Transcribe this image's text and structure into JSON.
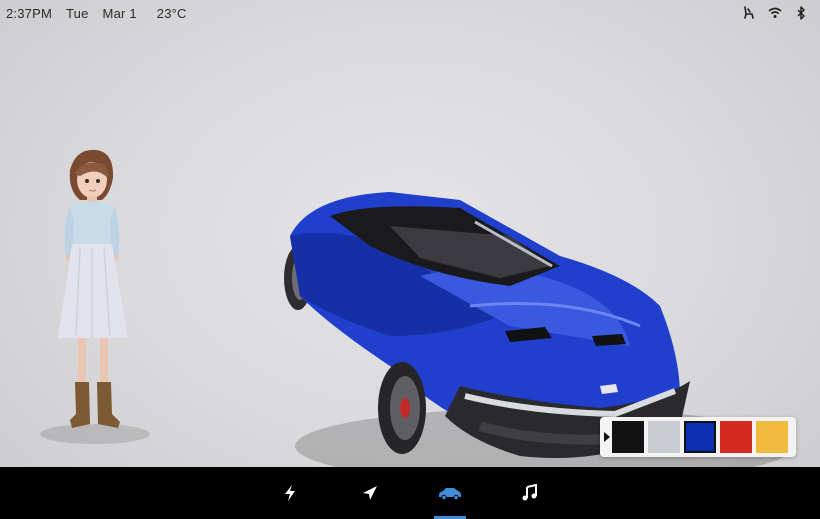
{
  "status": {
    "time": "2:37PM",
    "day": "Tue",
    "date": "Mar 1",
    "temperature": "23°C",
    "icons": [
      "seat-icon",
      "wifi-icon",
      "bluetooth-icon"
    ]
  },
  "color_picker": {
    "colors": [
      "#121212",
      "#c9ccd0",
      "#0c2fb4",
      "#d42a22",
      "#f0bb3c"
    ],
    "selected_index": 2
  },
  "nav": {
    "items": [
      {
        "icon": "lightning-icon",
        "active": false
      },
      {
        "icon": "navigation-arrow-icon",
        "active": false
      },
      {
        "icon": "car-icon",
        "active": true
      },
      {
        "icon": "music-note-icon",
        "active": false
      }
    ],
    "accent": "#3f8ed8"
  }
}
